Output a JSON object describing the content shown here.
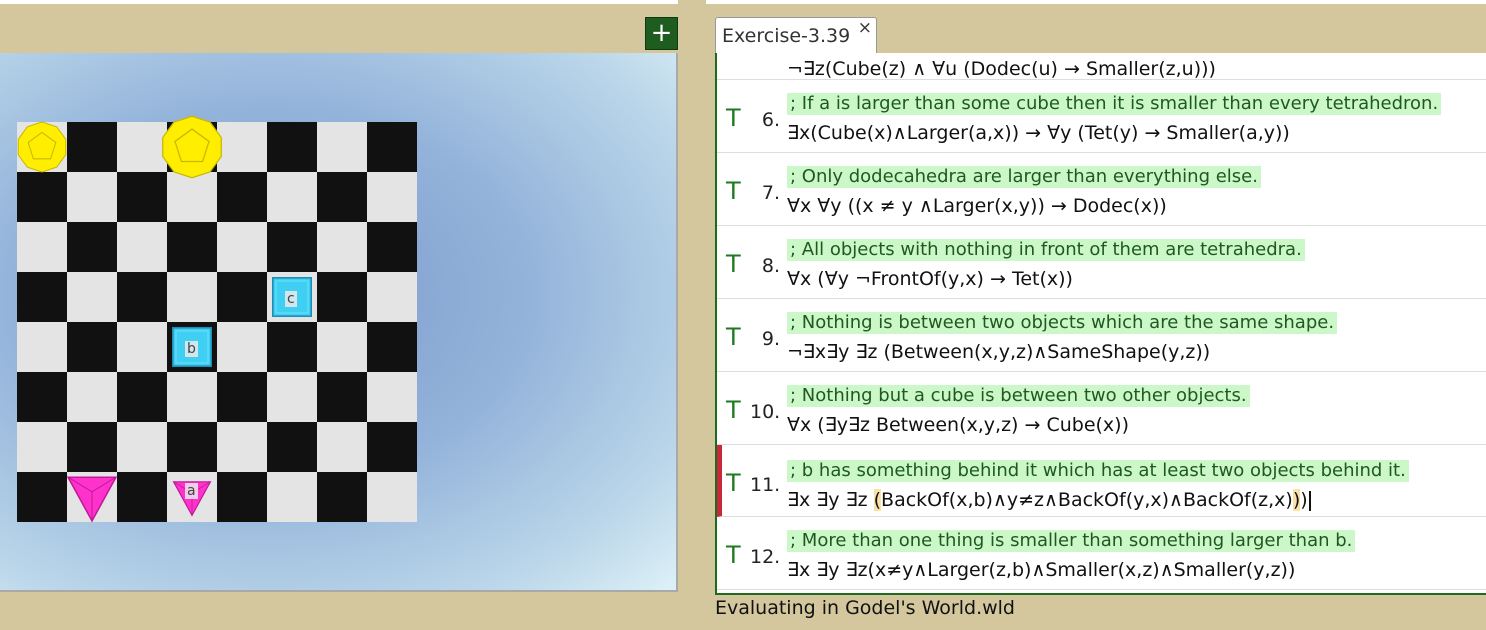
{
  "world": {
    "add_label": "+",
    "objects": [
      {
        "shape": "dodec",
        "size": "medium",
        "col": 0,
        "row": 0,
        "label": ""
      },
      {
        "shape": "dodec",
        "size": "large",
        "col": 3,
        "row": 0,
        "label": ""
      },
      {
        "shape": "cube",
        "size": "small",
        "col": 5,
        "row": 3,
        "label": "c"
      },
      {
        "shape": "cube",
        "size": "small",
        "col": 3,
        "row": 4,
        "label": "b"
      },
      {
        "shape": "tet",
        "size": "medium",
        "col": 1,
        "row": 7,
        "label": ""
      },
      {
        "shape": "tet",
        "size": "small",
        "col": 3,
        "row": 7,
        "label": "a"
      }
    ],
    "colors": {
      "dodec": "#ffee00",
      "cube": "#3ecff2",
      "tet": "#ff33cc"
    }
  },
  "tab": {
    "label": "Exercise-3.39",
    "close": "×"
  },
  "sentences": [
    {
      "num": "",
      "truth": "",
      "comment": "",
      "formula": "¬∃z(Cube(z) ∧ ∀u (Dodec(u) → Smaller(z,u)))"
    },
    {
      "num": "6.",
      "truth": "T",
      "comment": "; If a is larger than some cube then it is smaller than every tetrahedron.",
      "formula": "∃x(Cube(x)∧Larger(a,x)) → ∀y (Tet(y) → Smaller(a,y))"
    },
    {
      "num": "7.",
      "truth": "T",
      "comment": "; Only dodecahedra are larger than everything else.",
      "formula": "∀x ∀y ((x ≠ y ∧Larger(x,y)) → Dodec(x))"
    },
    {
      "num": "8.",
      "truth": "T",
      "comment": "; All objects with nothing in front of them are tetrahedra.",
      "formula": "∀x (∀y ¬FrontOf(y,x) → Tet(x))"
    },
    {
      "num": "9.",
      "truth": "T",
      "comment": "; Nothing is between two objects which are the same shape.",
      "formula": "¬∃x∃y ∃z (Between(x,y,z)∧SameShape(y,z))"
    },
    {
      "num": "10.",
      "truth": "T",
      "comment": "; Nothing but a cube is between two other objects.",
      "formula": "∀x (∃y∃z Between(x,y,z) → Cube(x))"
    },
    {
      "num": "11.",
      "truth": "T",
      "comment": "; b has something behind it which has at least two objects behind it.",
      "formula_pre": "∃x ∃y ∃z ",
      "paren_open": "(",
      "formula_mid": "BackOf(x,b)∧y≠z∧BackOf(y,x)∧BackOf(z,x)",
      "paren_close": ")",
      "formula_last": ")"
    },
    {
      "num": "12.",
      "truth": "T",
      "comment": "; More than one thing is smaller than something larger than b.",
      "formula": "∃x ∃y ∃z(x≠y∧Larger(z,b)∧Smaller(x,z)∧Smaller(y,z))"
    }
  ],
  "status": "Evaluating in Godel's World.wld"
}
